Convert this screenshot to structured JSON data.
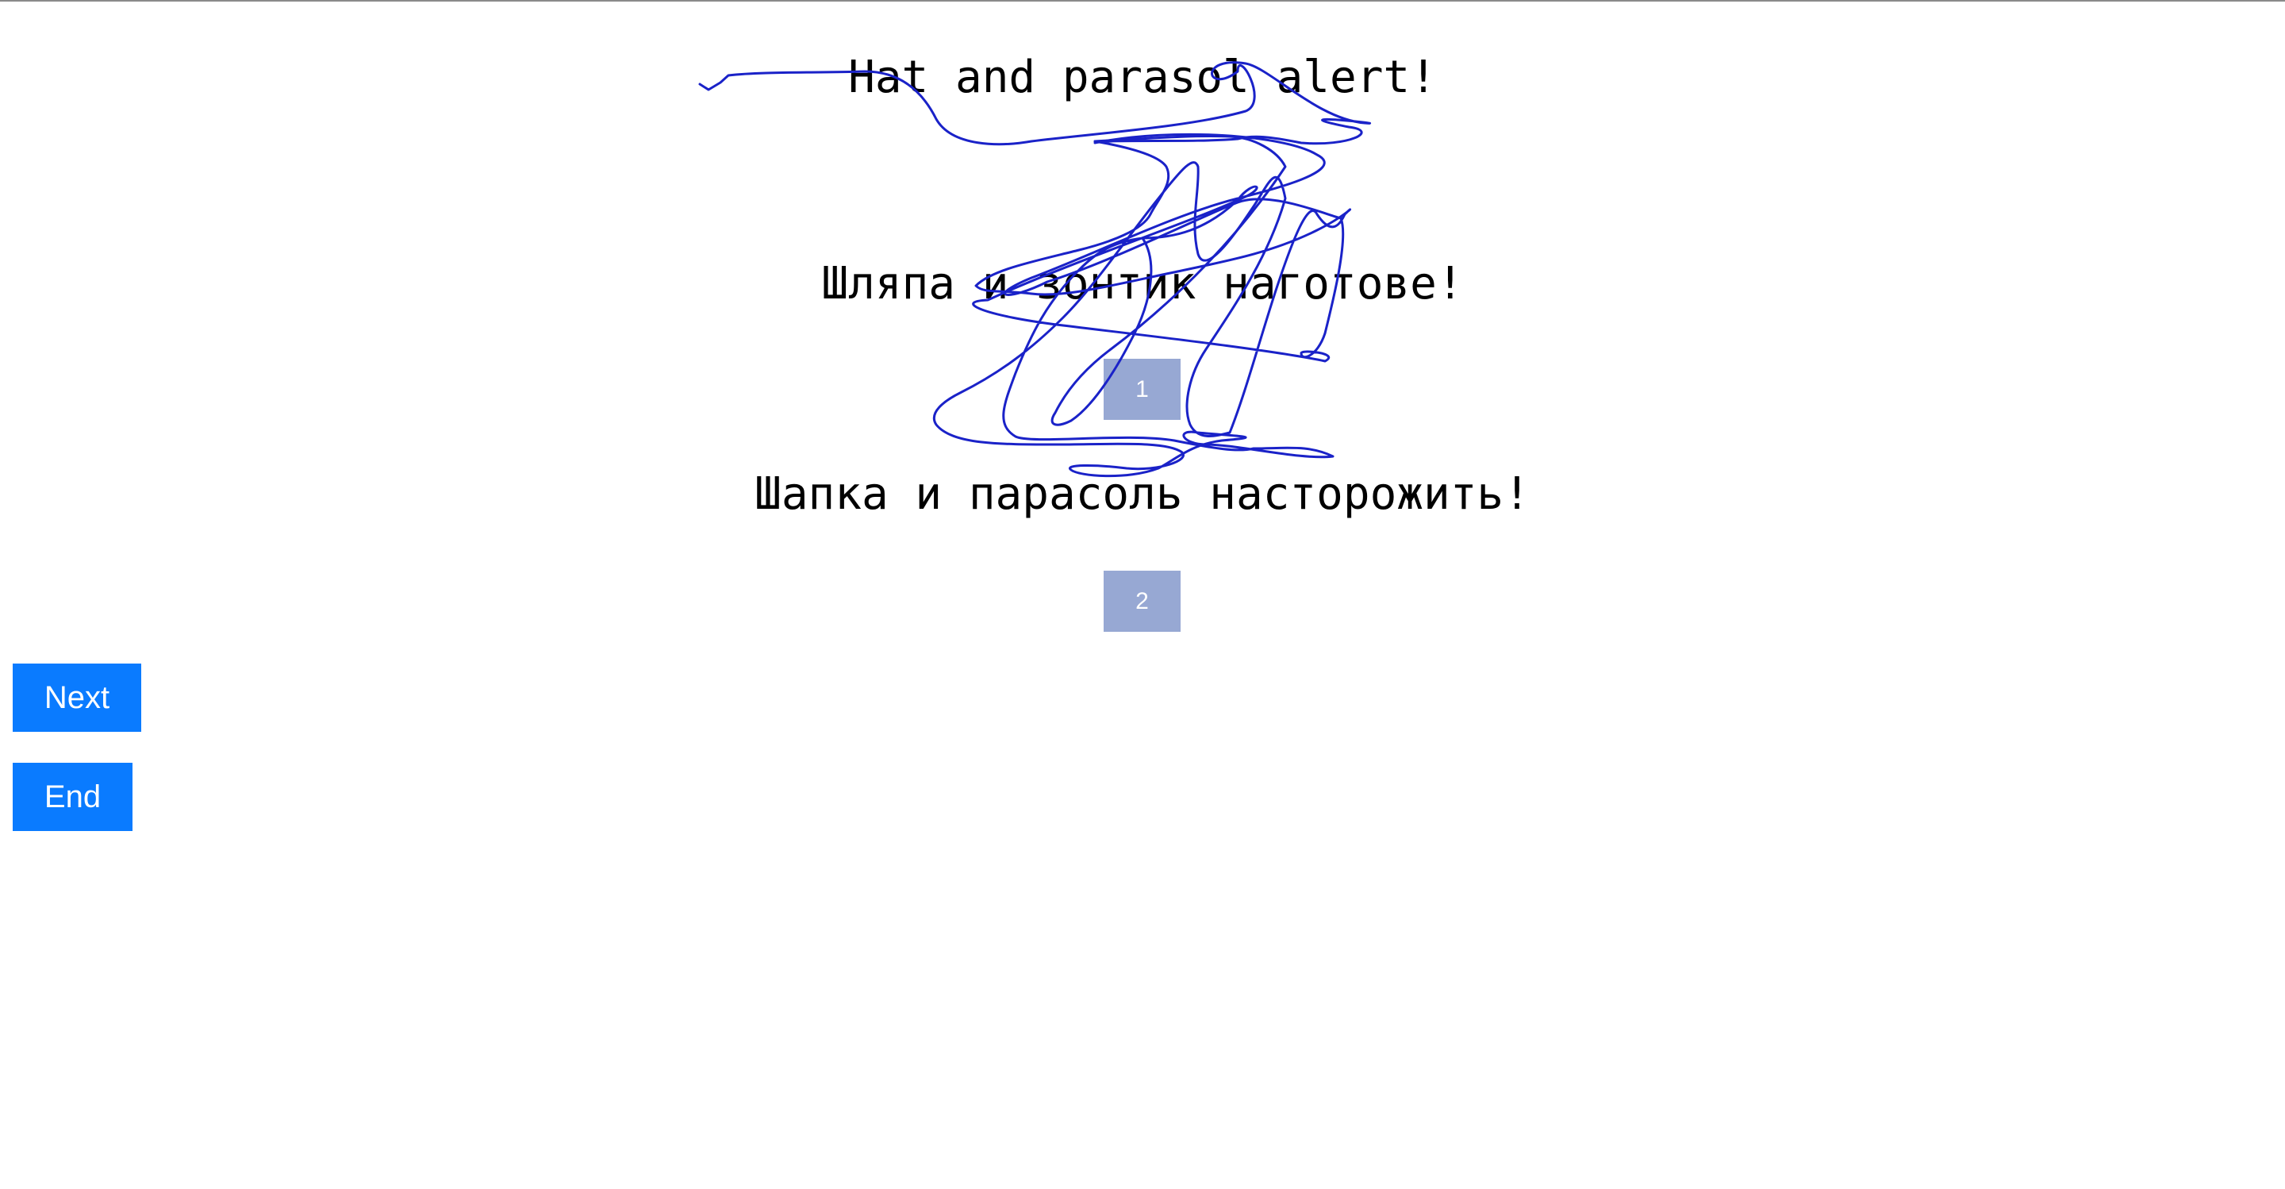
{
  "prompt": "Hat and parasol alert!",
  "options": [
    {
      "text": "Шляпа и зонтик наготове!",
      "button_label": "1"
    },
    {
      "text": "Шапка и парасоль насторожить!",
      "button_label": "2"
    }
  ],
  "nav": {
    "next_label": "Next",
    "end_label": "End"
  },
  "colors": {
    "choice_button_bg": "#97a8d3",
    "nav_button_bg": "#0a7bff",
    "scribble_stroke": "#1a22c8"
  }
}
